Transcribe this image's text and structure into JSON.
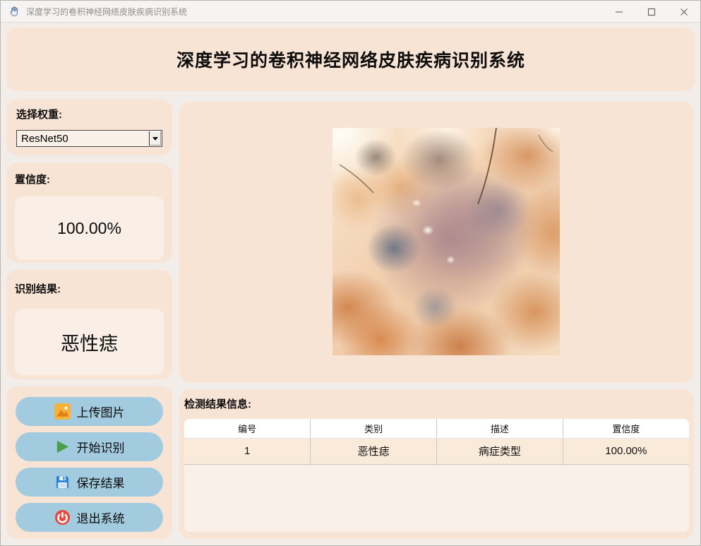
{
  "window": {
    "title": "深度学习的卷积神经网络皮肤疾病识别系统"
  },
  "header": {
    "title": "深度学习的卷积神经网络皮肤疾病识别系统"
  },
  "sidebar": {
    "weight": {
      "label": "选择权重:",
      "selected": "ResNet50"
    },
    "confidence": {
      "label": "置信度:",
      "value": "100.00%"
    },
    "result": {
      "label": "识别结果:",
      "value": "恶性痣"
    },
    "buttons": [
      {
        "label": "上传图片",
        "icon": "image-icon"
      },
      {
        "label": "开始识别",
        "icon": "play-icon"
      },
      {
        "label": "保存结果",
        "icon": "save-icon"
      },
      {
        "label": "退出系统",
        "icon": "power-icon"
      }
    ]
  },
  "main": {
    "image": {
      "alt": "皮肤病灶显微图像"
    },
    "results": {
      "label": "检测结果信息:",
      "table": {
        "headers": [
          "编号",
          "类别",
          "描述",
          "置信度"
        ],
        "rows": [
          [
            "1",
            "恶性痣",
            "病症类型",
            "100.00%"
          ]
        ]
      }
    }
  },
  "icons": {
    "titlebar": "hand-icon",
    "window_controls": [
      "minimize-icon",
      "maximize-icon",
      "close-icon"
    ],
    "combo": "chevron-down-icon"
  },
  "colors": {
    "panel": "#f7e4d5",
    "inner_box": "#f9efe7",
    "button_blue": "#a2cbdf",
    "confidence_green": "#0aa00a",
    "background": "#f2ede8"
  }
}
